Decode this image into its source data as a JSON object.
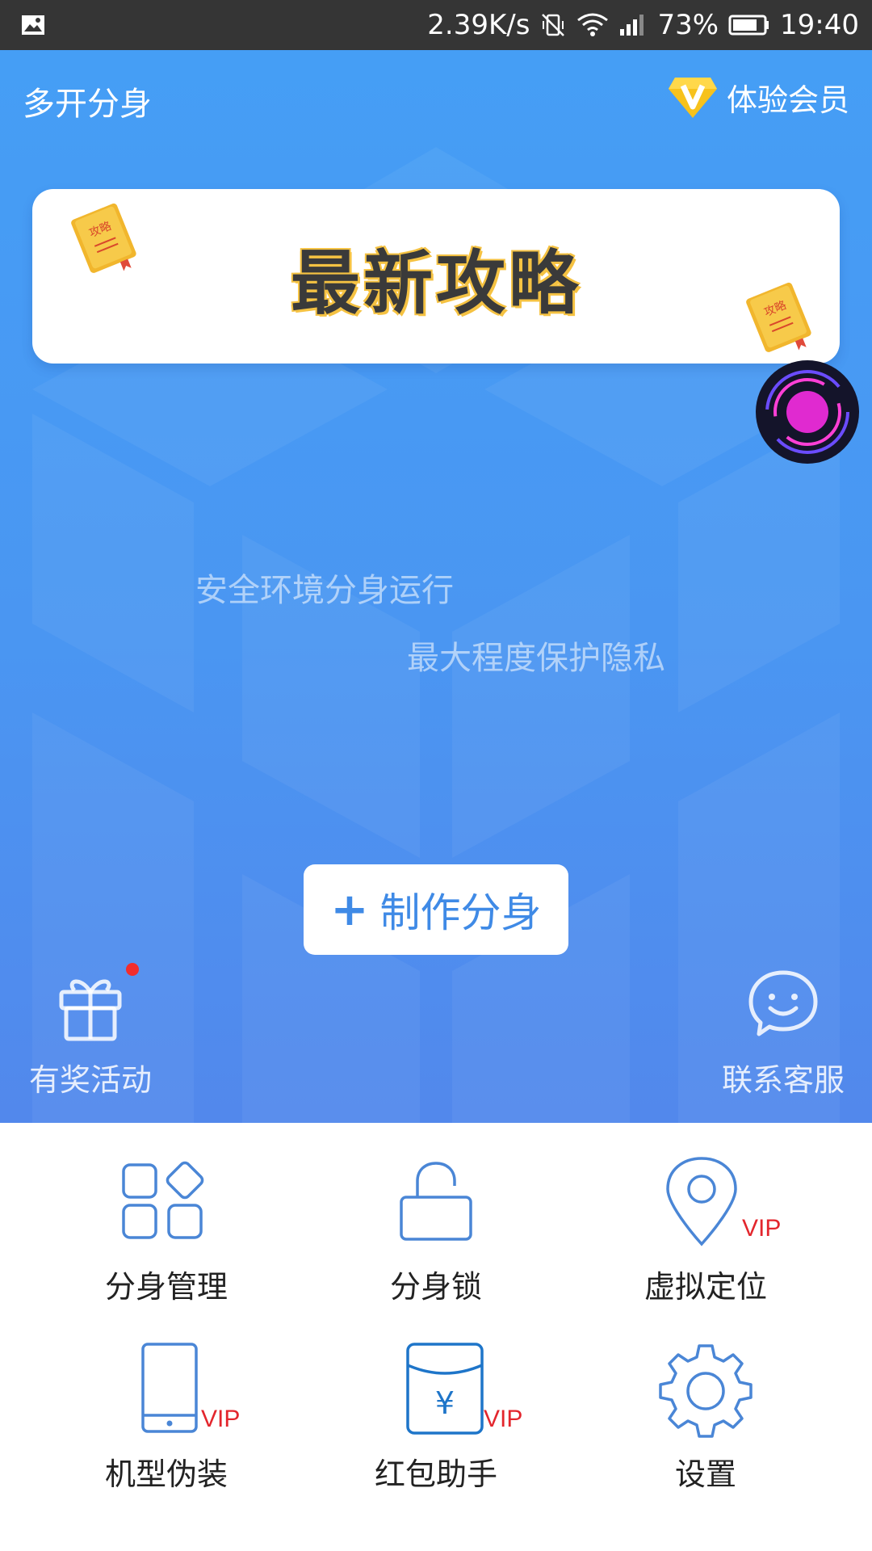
{
  "status_bar": {
    "network_speed": "2.39K/s",
    "battery": "73%",
    "time": "19:40",
    "icons": [
      "image-icon",
      "vibrate-off-icon",
      "wifi-icon",
      "signal-icon",
      "battery-icon"
    ]
  },
  "header": {
    "app_title": "多开分身",
    "vip_label": "体验会员"
  },
  "banner": {
    "title": "最新攻略",
    "book_label": "攻略"
  },
  "taglines": [
    "安全环境分身运行",
    "最大程度保护隐私"
  ],
  "create_button": {
    "plus": "+",
    "label": "制作分身"
  },
  "side_actions": {
    "activity": "有奖活动",
    "service": "联系客服"
  },
  "features": [
    {
      "label": "分身管理",
      "icon": "apps-grid-icon",
      "vip": ""
    },
    {
      "label": "分身锁",
      "icon": "lock-icon",
      "vip": ""
    },
    {
      "label": "虚拟定位",
      "icon": "location-pin-icon",
      "vip": "VIP"
    },
    {
      "label": "机型伪装",
      "icon": "phone-icon",
      "vip": "VIP"
    },
    {
      "label": "红包助手",
      "icon": "red-envelope-icon",
      "vip": "VIP"
    },
    {
      "label": "设置",
      "icon": "gear-icon",
      "vip": ""
    }
  ],
  "colors": {
    "hero_top": "#459ef5",
    "hero_bottom": "#5288ec",
    "icon_blue": "#4a86d6",
    "vip_red": "#e3262d",
    "create_text": "#3f8ae6",
    "badge_gold": "#f7c21c"
  }
}
